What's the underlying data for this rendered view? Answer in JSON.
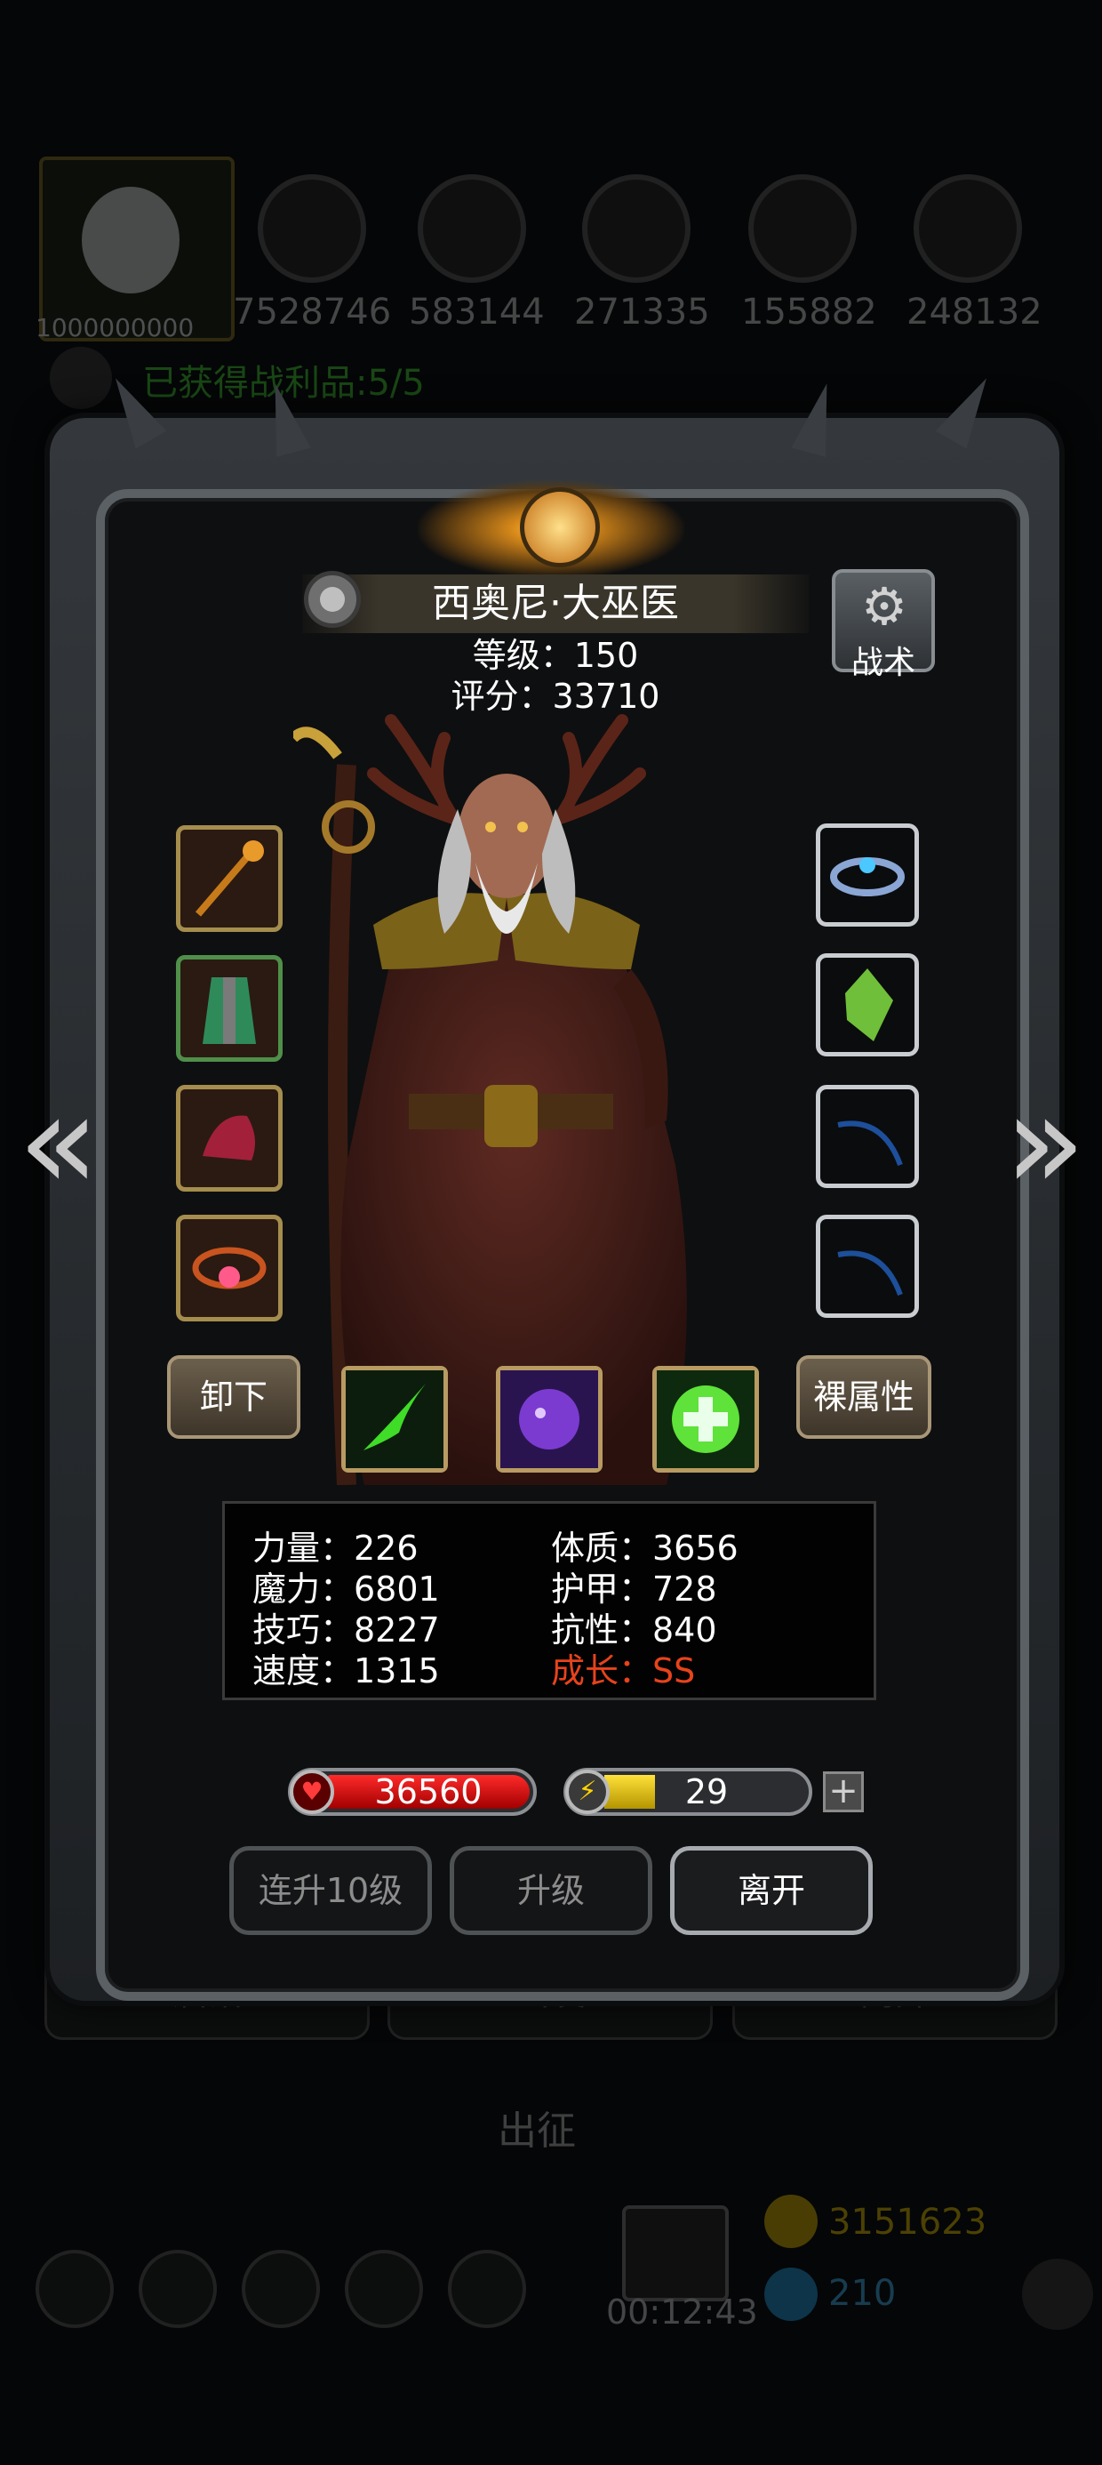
{
  "background": {
    "player_level": "1000000000",
    "resources": [
      "7528746",
      "583144",
      "271335",
      "155882",
      "248132"
    ],
    "loot_status": "已获得战利品:5/5",
    "tabs": [
      "酒馆",
      "出发",
      "离开"
    ],
    "march_label": "出征",
    "chest_timer": "00:12:43",
    "gold_amount": "3151623",
    "gem_amount": "210"
  },
  "hero": {
    "name": "西奥尼·大巫医",
    "level_text": "等级：150",
    "score_text": "评分：33710"
  },
  "tactics_button": {
    "label": "战术",
    "icon": "gear-icon"
  },
  "equipment_left": [
    {
      "name": "staff",
      "color": "#c77a1a"
    },
    {
      "name": "robe",
      "color": "#2f8a5a"
    },
    {
      "name": "hood",
      "color": "#a2203a"
    },
    {
      "name": "amulet",
      "color": "#c9541f"
    }
  ],
  "equipment_right": [
    {
      "name": "ring",
      "color": "#8aa6d4"
    },
    {
      "name": "gem",
      "color": "#6fbf3a"
    },
    {
      "name": "empty",
      "color": "#1d4f9a"
    },
    {
      "name": "empty",
      "color": "#1d4f9a"
    }
  ],
  "actions": {
    "unequip_label": "卸下",
    "base_attr_label": "裸属性"
  },
  "skills": [
    {
      "name": "green-bolt",
      "color": "#3fdc28"
    },
    {
      "name": "purple-beast",
      "color": "#7b3bd0"
    },
    {
      "name": "heal-cross",
      "color": "#5fe23a"
    }
  ],
  "stats": {
    "strength": "力量：226",
    "magic": "魔力：6801",
    "skill": "技巧：8227",
    "speed": "速度：1315",
    "constitution": "体质：3656",
    "armor": "护甲：728",
    "resistance": "抗性：840",
    "growth": "成长：SS",
    "growth_color": "#e8431b"
  },
  "bars": {
    "hp": "36560",
    "energy": "29",
    "energy_fill": 0.25
  },
  "buttons": {
    "level10": "连升10级",
    "levelup": "升级",
    "leave": "离开"
  }
}
